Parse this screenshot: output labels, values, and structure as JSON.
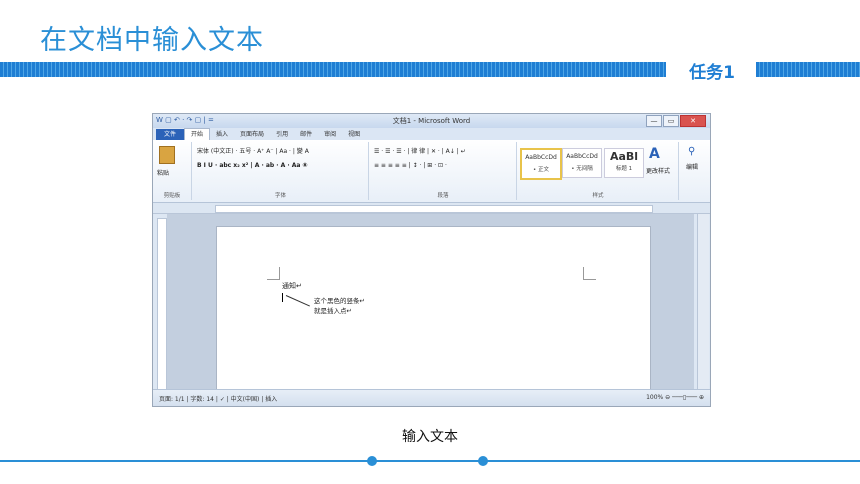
{
  "slide": {
    "title": "在文档中输入文本",
    "task_label": "任务1",
    "caption": "输入文本"
  },
  "word": {
    "window_title": "文档1 - Microsoft Word",
    "quick_access": "W ▢ ↶ · ↷ ▢ | =",
    "window_buttons": {
      "minimize": "—",
      "maximize": "▭",
      "close": "✕"
    },
    "tabs": [
      "文件",
      "开始",
      "插入",
      "页面布局",
      "引用",
      "邮件",
      "审阅",
      "视图"
    ],
    "ribbon": {
      "clipboard": {
        "paste": "粘贴",
        "label": "剪贴板"
      },
      "font": {
        "face": "宋体 (中文正)",
        "size": "五号",
        "row2": "B I U · abc x₂ x² | A · ab · A · Aa ⑧",
        "label": "字体"
      },
      "paragraph": {
        "row1": "☰ · ☰ · ☰ · | 律 律 | ✕ · | A↓ | ↵",
        "row2": "≡ ≡ ≡ ≡ ≡ | ↕ · | ⊞ · ⊡ ·",
        "label": "段落"
      },
      "styles": {
        "items": [
          {
            "sample": "AaBbCcDd",
            "name": "• 正文"
          },
          {
            "sample": "AaBbCcDd",
            "name": "• 无间隔"
          },
          {
            "sample": "AaBl",
            "name": "标题 1"
          }
        ],
        "change": "更改样式",
        "label": "样式"
      },
      "editing": {
        "label": "编辑"
      }
    },
    "document": {
      "line1": "通知↵",
      "callout_line1": "这个黑色的竖条↵",
      "callout_line2": "就是插入点↵"
    },
    "status": {
      "left": "页面: 1/1 | 字数: 14 | ✓ | 中文(中国) | 插入",
      "zoom": "100%"
    }
  }
}
